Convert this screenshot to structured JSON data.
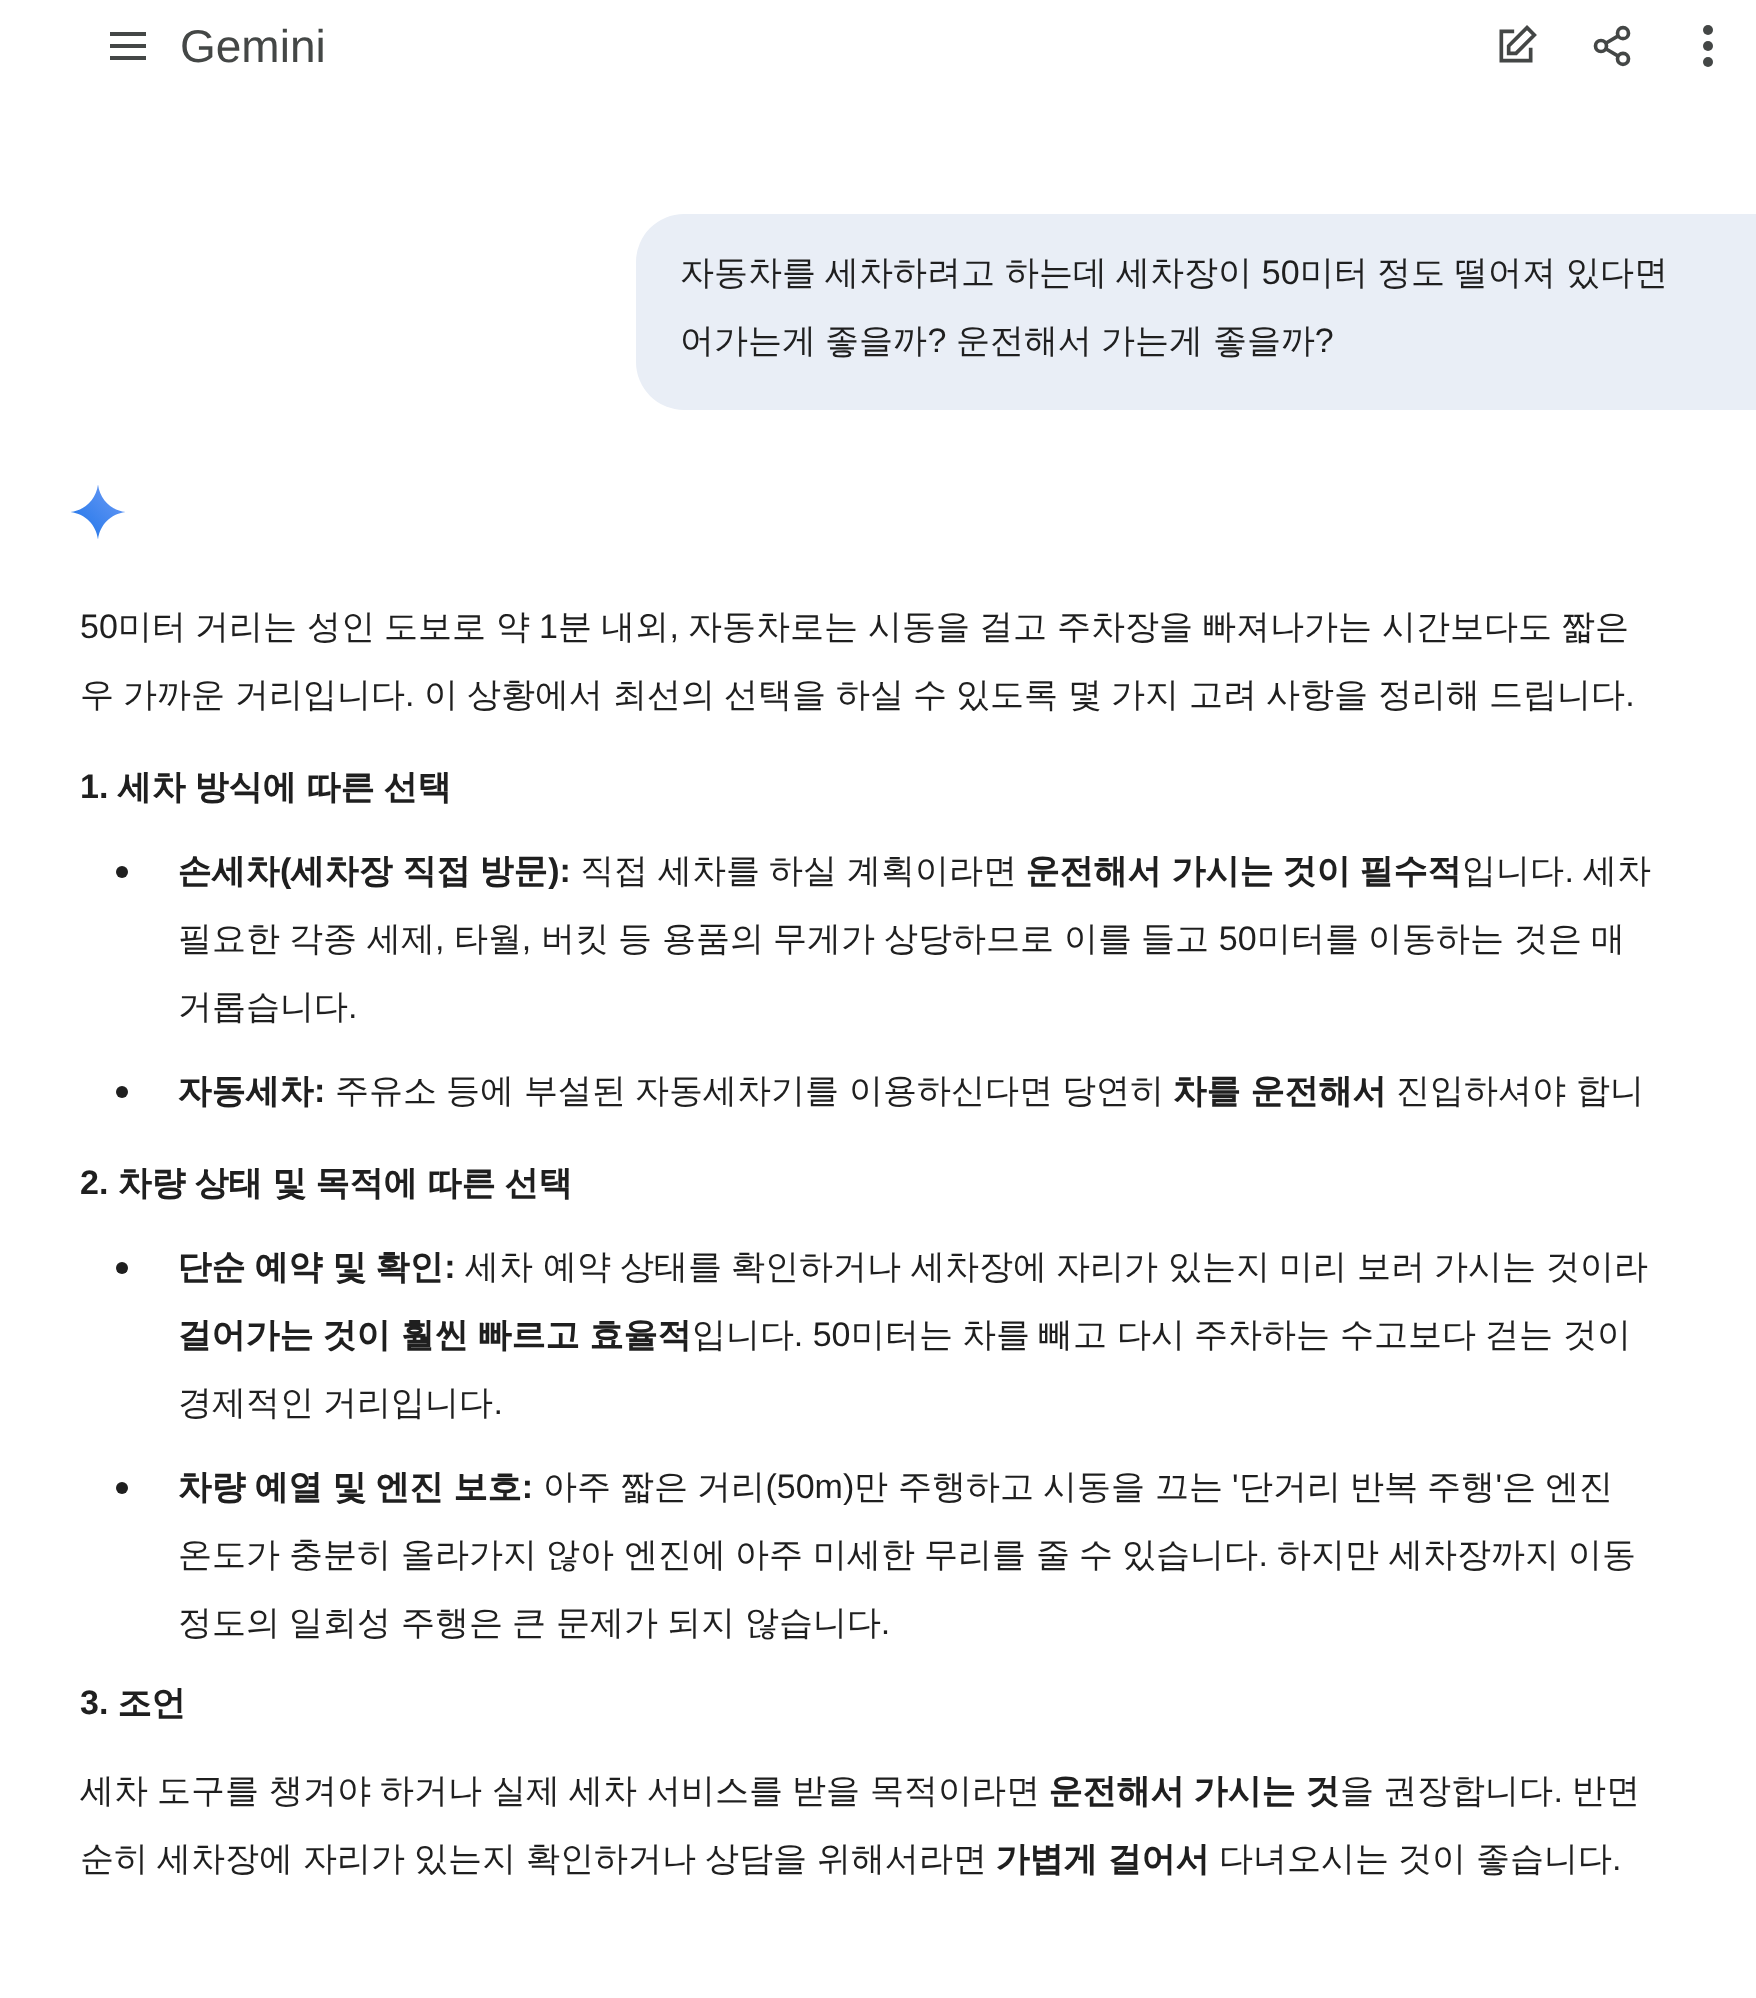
{
  "app_bar": {
    "title": "Gemini"
  },
  "user_message": {
    "lines": [
      "자동차를 세차하려고 하는데 세차장이 50미터 정도 떨어져 있다면",
      "어가는게 좋을까? 운전해서 가는게 좋을까?"
    ]
  },
  "response": {
    "blocks": [
      {
        "kind": "paragraph",
        "lines": [
          "50미터 거리는 성인 도보로 약 1분 내외, 자동차로는 시동을 걸고 주차장을 빠져나가는 시간보다도 짧은",
          "우 가까운 거리입니다. 이 상황에서 최선의 선택을 하실 수 있도록 몇 가지 고려 사항을 정리해 드립니다."
        ]
      },
      {
        "kind": "heading",
        "text": "1. 세차 방식에 따른 선택"
      },
      {
        "kind": "bullet",
        "lines": [
          "**손세차(세차장 직접 방문):** 직접 세차를 하실 계획이라면 **운전해서 가시는 것이 필수적**입니다. 세차",
          "필요한 각종 세제, 타월, 버킷 등 용품의 무게가 상당하므로 이를 들고 50미터를 이동하는 것은 매",
          "거롭습니다."
        ]
      },
      {
        "kind": "bullet",
        "lines": [
          "**자동세차:** 주유소 등에 부설된 자동세차기를 이용하신다면 당연히 **차를 운전해서** 진입하셔야 합니"
        ]
      },
      {
        "kind": "heading",
        "text": "2. 차량 상태 및 목적에 따른 선택"
      },
      {
        "kind": "bullet",
        "lines": [
          "**단순 예약 및 확인:** 세차 예약 상태를 확인하거나 세차장에 자리가 있는지 미리 보러 가시는 것이라",
          "**걸어가는 것이 훨씬 빠르고 효율적**입니다. 50미터는 차를 빼고 다시 주차하는 수고보다 걷는 것이",
          "경제적인 거리입니다."
        ]
      },
      {
        "kind": "bullet",
        "lines": [
          "**차량 예열 및 엔진 보호:** 아주 짧은 거리(50m)만 주행하고 시동을 끄는 '단거리 반복 주행'은 엔진",
          "온도가 충분히 올라가지 않아 엔진에 아주 미세한 무리를 줄 수 있습니다. 하지만 세차장까지 이동",
          "정도의 일회성 주행은 큰 문제가 되지 않습니다."
        ]
      },
      {
        "kind": "heading",
        "text": "3. 조언"
      },
      {
        "kind": "paragraph",
        "lines": [
          "세차 도구를 챙겨야 하거나 실제 세차 서비스를 받을 목적이라면 **운전해서 가시는 것**을 권장합니다. 반면",
          "순히 세차장에 자리가 있는지 확인하거나 상담을 위해서라면 **가볍게 걸어서** 다녀오시는 것이 좋습니다."
        ]
      }
    ]
  }
}
